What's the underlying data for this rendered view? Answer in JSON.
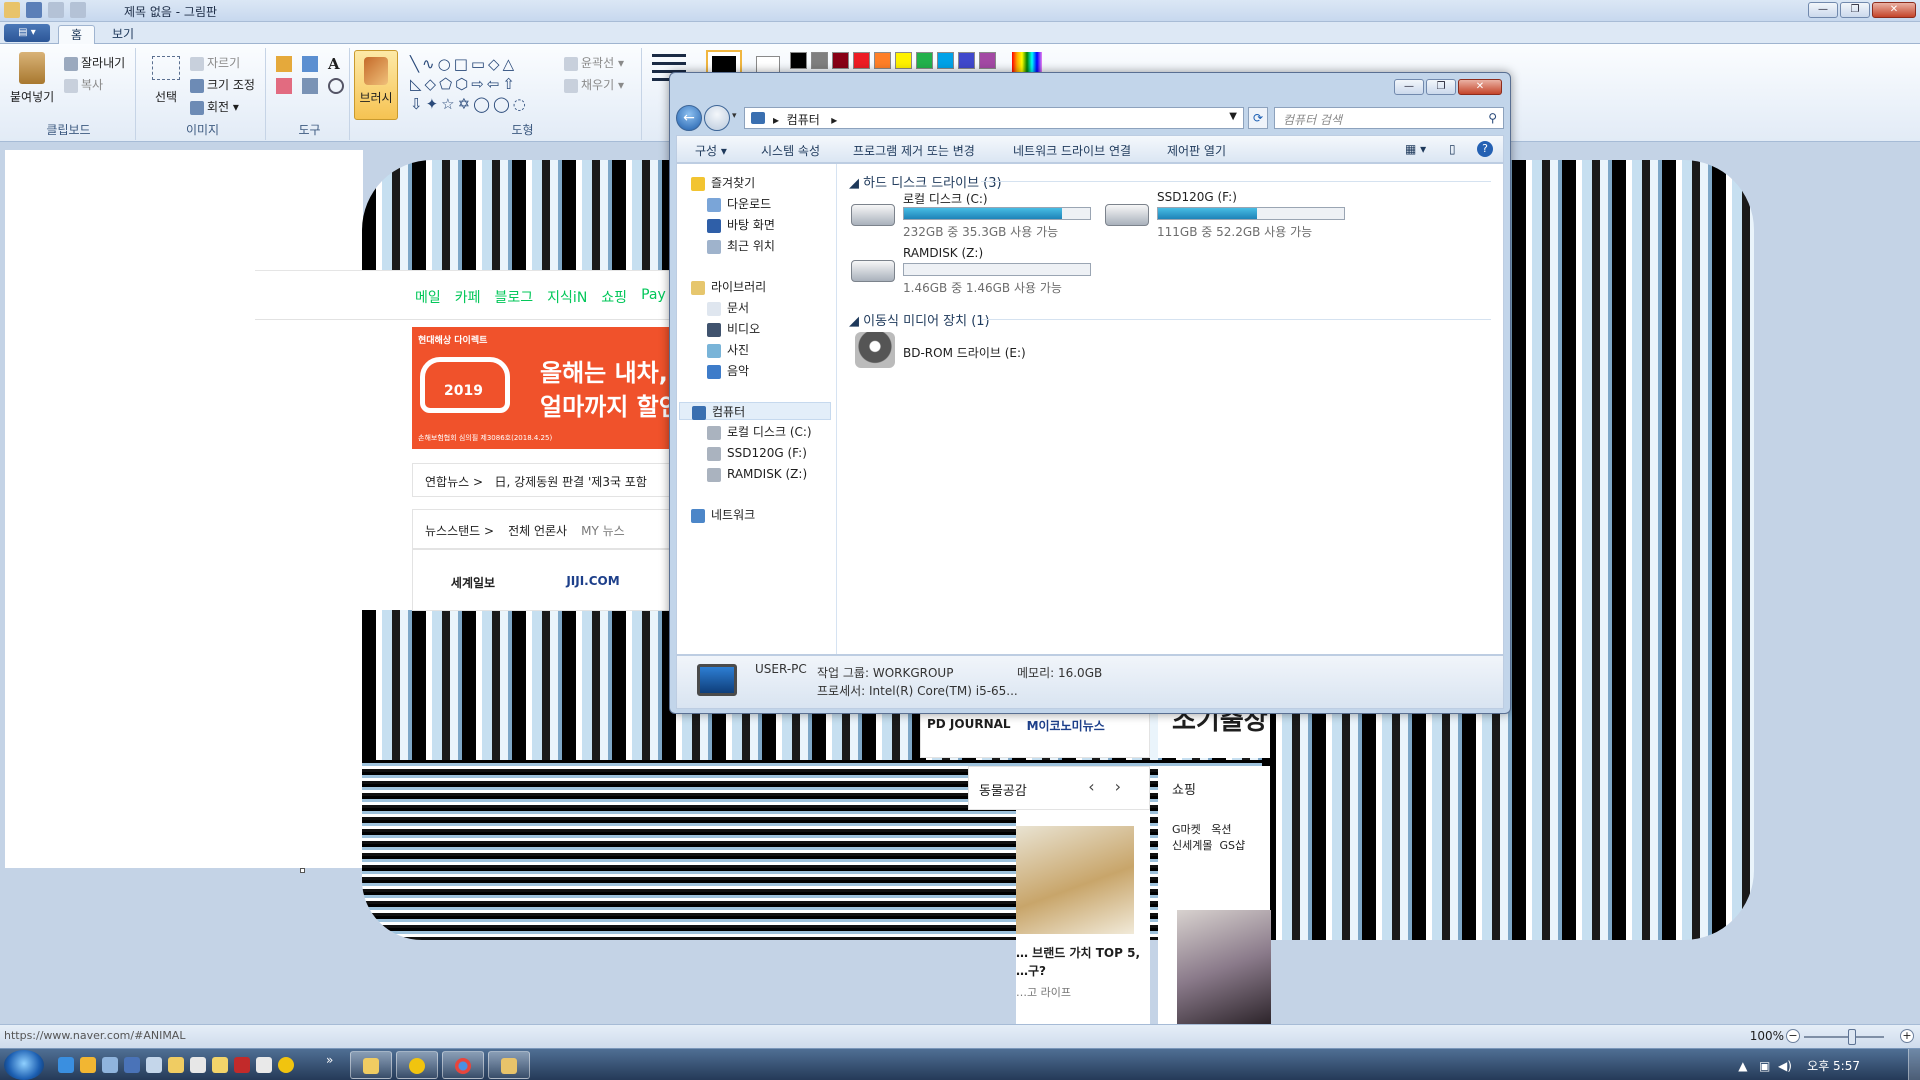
{
  "paint": {
    "title": "제목 없음 - 그림판",
    "tabs": [
      "홈",
      "보기"
    ],
    "clipboard": {
      "paste": "붙여넣기",
      "cut": "잘라내기",
      "copy": "복사",
      "group": "클립보드"
    },
    "image": {
      "select": "선택",
      "crop": "자르기",
      "resize": "크기 조정",
      "rotate": "회전",
      "group": "이미지"
    },
    "tools": {
      "group": "도구",
      "brush": "브러시"
    },
    "shapes": {
      "group": "도형",
      "outline": "윤곽선",
      "fill": "채우기"
    },
    "colors": {
      "color1": "#000000",
      "color2": "#ffffff",
      "palette": [
        "#000000",
        "#7f7f7f",
        "#880015",
        "#ed1c24",
        "#ff7f27",
        "#fff200",
        "#22b14c",
        "#00a2e8",
        "#3f48cc",
        "#a349a4"
      ]
    },
    "status": {
      "url": "https://www.naver.com/#ANIMAL",
      "zoom": "100%"
    }
  },
  "web": {
    "nav": [
      "메일",
      "카페",
      "블로그",
      "지식iN",
      "쇼핑",
      "Pay"
    ],
    "ad": {
      "brand": "현대해상 다이렉트",
      "year": "2019",
      "line1": "올해는 내차,",
      "line2": "얼마까지 할인",
      "fine": "손해보험협회 심의필 제3086호(2018.4.25)"
    },
    "news": {
      "source": "연합뉴스",
      "headline": "日, 강제동원 판결 '제3국 포함"
    },
    "newsstand": {
      "label": "뉴스스탠드",
      "all": "전체 언론사",
      "my": "MY 뉴스"
    },
    "papers": [
      "세계일보",
      "JIJI.COM"
    ],
    "papers2": [
      "PD JOURNAL",
      "M이코노미뉴스"
    ],
    "big_text": "조기출장",
    "animal_tab": "동물공감",
    "shopping": "쇼핑",
    "card_title": "… 브랜드 가치 TOP 5, …구?",
    "card_sub": "…고 라이프",
    "shop_items": [
      "G마켓",
      "옥션",
      "신세계몰",
      "GS샵"
    ]
  },
  "explorer": {
    "address": "컴퓨터",
    "search_placeholder": "컴퓨터 검색",
    "commands": [
      "구성",
      "시스템 속성",
      "프로그램 제거 또는 변경",
      "네트워크 드라이브 연결",
      "제어판 열기"
    ],
    "nav": {
      "favorites": "즐겨찾기",
      "fav_items": [
        "다운로드",
        "바탕 화면",
        "최근 위치"
      ],
      "libraries": "라이브러리",
      "lib_items": [
        "문서",
        "비디오",
        "사진",
        "음악"
      ],
      "computer": "컴퓨터",
      "comp_items": [
        "로컬 디스크 (C:)",
        "SSD120G (F:)",
        "RAMDISK (Z:)"
      ],
      "network": "네트워크"
    },
    "hdd_section": "하드 디스크 드라이브 (3)",
    "removable_section": "이동식 미디어 장치 (1)",
    "drives": [
      {
        "name": "로컬 디스크 (C:)",
        "free": "232GB 중 35.3GB 사용 가능",
        "used": 0.85
      },
      {
        "name": "SSD120G (F:)",
        "free": "111GB 중 52.2GB 사용 가능",
        "used": 0.53
      },
      {
        "name": "RAMDISK (Z:)",
        "free": "1.46GB 중 1.46GB 사용 가능",
        "used": 0.0
      }
    ],
    "bd": {
      "name": "BD-ROM 드라이브 (E:)"
    },
    "details": {
      "pc_name": "USER-PC",
      "workgroup": "작업 그룹: WORKGROUP",
      "memory": "메모리: 16.0GB",
      "processor": "프로세서: Intel(R) Core(TM) i5-65..."
    }
  },
  "taskbar": {
    "time": "오후 5:57"
  }
}
